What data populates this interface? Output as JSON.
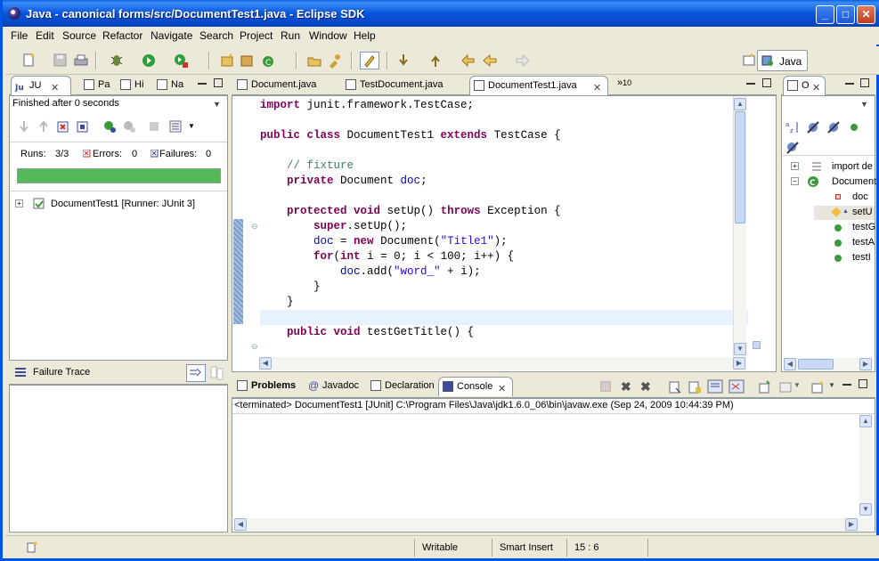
{
  "window": {
    "title": "Java - canonical forms/src/DocumentTest1.java - Eclipse SDK"
  },
  "menu": [
    "File",
    "Edit",
    "Source",
    "Refactor",
    "Navigate",
    "Search",
    "Project",
    "Run",
    "Window",
    "Help"
  ],
  "perspective": {
    "label": "Java"
  },
  "left_panel": {
    "tabs": [
      {
        "label": "JU"
      },
      {
        "label": "Pa"
      },
      {
        "label": "Hi"
      },
      {
        "label": "Na"
      }
    ],
    "status": "Finished after 0 seconds",
    "runs_label": "Runs:",
    "runs_value": "3/3",
    "errors_label": "Errors:",
    "errors_value": "0",
    "failures_label": "Failures:",
    "failures_value": "0",
    "progress": 1.0,
    "progress_color": "#55b95a",
    "tree_item": "DocumentTest1 [Runner: JUnit 3]",
    "failure_trace_label": "Failure Trace"
  },
  "editor": {
    "tabs": [
      {
        "label": "Document.java"
      },
      {
        "label": "TestDocument.java"
      },
      {
        "label": "DocumentTest1.java"
      }
    ],
    "overflow_count": "10",
    "lines": [
      {
        "segments": [
          {
            "t": "import",
            "c": "kw"
          },
          {
            "t": " junit.framework.TestCase;",
            "c": ""
          }
        ]
      },
      {
        "segments": []
      },
      {
        "segments": [
          {
            "t": "public class",
            "c": "kw"
          },
          {
            "t": " DocumentTest1 ",
            "c": ""
          },
          {
            "t": "extends",
            "c": "kw"
          },
          {
            "t": " TestCase {",
            "c": ""
          }
        ]
      },
      {
        "segments": []
      },
      {
        "segments": [
          {
            "t": "    // fixture",
            "c": "cm"
          }
        ]
      },
      {
        "segments": [
          {
            "t": "    ",
            "c": ""
          },
          {
            "t": "private",
            "c": "kw"
          },
          {
            "t": " Document ",
            "c": ""
          },
          {
            "t": "doc",
            "c": "fld"
          },
          {
            "t": ";",
            "c": ""
          }
        ]
      },
      {
        "segments": []
      },
      {
        "segments": [
          {
            "t": "    ",
            "c": ""
          },
          {
            "t": "protected void",
            "c": "kw"
          },
          {
            "t": " setUp() ",
            "c": ""
          },
          {
            "t": "throws",
            "c": "kw"
          },
          {
            "t": " Exception {",
            "c": ""
          }
        ]
      },
      {
        "segments": [
          {
            "t": "        ",
            "c": ""
          },
          {
            "t": "super",
            "c": "kw"
          },
          {
            "t": ".setUp();",
            "c": ""
          }
        ]
      },
      {
        "segments": [
          {
            "t": "        ",
            "c": ""
          },
          {
            "t": "doc",
            "c": "fld"
          },
          {
            "t": " = ",
            "c": ""
          },
          {
            "t": "new",
            "c": "kw"
          },
          {
            "t": " Document(",
            "c": ""
          },
          {
            "t": "\"Title1\"",
            "c": "str"
          },
          {
            "t": ");",
            "c": ""
          }
        ]
      },
      {
        "segments": [
          {
            "t": "        ",
            "c": ""
          },
          {
            "t": "for",
            "c": "kw"
          },
          {
            "t": "(",
            "c": ""
          },
          {
            "t": "int",
            "c": "kw"
          },
          {
            "t": " i = 0; i < 100; i++) {",
            "c": ""
          }
        ]
      },
      {
        "segments": [
          {
            "t": "            ",
            "c": ""
          },
          {
            "t": "doc",
            "c": "fld"
          },
          {
            "t": ".add(",
            "c": ""
          },
          {
            "t": "\"word_\"",
            "c": "str"
          },
          {
            "t": " + i);",
            "c": ""
          }
        ]
      },
      {
        "segments": [
          {
            "t": "        }",
            "c": ""
          }
        ]
      },
      {
        "segments": [
          {
            "t": "    }",
            "c": ""
          }
        ]
      },
      {
        "segments": []
      },
      {
        "segments": [
          {
            "t": "    ",
            "c": ""
          },
          {
            "t": "public void",
            "c": "kw"
          },
          {
            "t": " testGetTitle() {",
            "c": ""
          }
        ]
      }
    ]
  },
  "outline": {
    "tab_label": "O",
    "items": [
      {
        "label": "import de"
      },
      {
        "label": "Document"
      },
      {
        "label": "doc"
      },
      {
        "label": "setU"
      },
      {
        "label": "testG"
      },
      {
        "label": "testA"
      },
      {
        "label": "testI"
      }
    ]
  },
  "bottom_panel": {
    "tabs": [
      {
        "label": "Problems"
      },
      {
        "label": "Javadoc"
      },
      {
        "label": "Declaration"
      },
      {
        "label": "Console"
      }
    ],
    "console_header": "<terminated> DocumentTest1 [JUnit] C:\\Program Files\\Java\\jdk1.6.0_06\\bin\\javaw.exe (Sep 24, 2009 10:44:39 PM)"
  },
  "status": {
    "writable": "Writable",
    "insert_mode": "Smart Insert",
    "position": "15 : 6"
  }
}
